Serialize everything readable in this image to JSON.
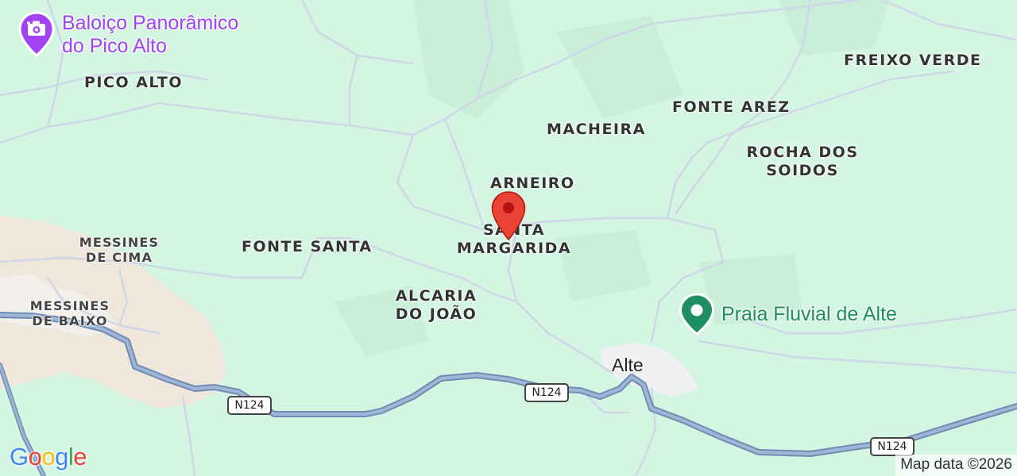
{
  "map": {
    "background_color": "#d3f5e1",
    "urban_color": "#efe6dc",
    "road_color": "#8aa5c8",
    "road_outline_color": "#6f8cb3",
    "minor_road_color": "#cfd6e6",
    "place_labels": [
      {
        "id": "pico-alto",
        "text": "PICO ALTO"
      },
      {
        "id": "freixo-verde",
        "text": "FREIXO VERDE"
      },
      {
        "id": "fonte-arez",
        "text": "FONTE AREZ"
      },
      {
        "id": "macheira",
        "text": "MACHEIRA"
      },
      {
        "id": "rocha-dos-soidos",
        "text": "ROCHA DOS\nSOIDOS"
      },
      {
        "id": "arneiro",
        "text": "ARNEIRO"
      },
      {
        "id": "santa-margarida",
        "text": "SANTA\nMARGARIDA"
      },
      {
        "id": "fonte-santa",
        "text": "FONTE SANTA"
      },
      {
        "id": "messines-de-cima",
        "text": "MESSINES\nDE CIMA"
      },
      {
        "id": "messines-de-baixo",
        "text": "MESSINES\nDE BAIXO"
      },
      {
        "id": "alcaria-do-joao",
        "text": "ALCARIA\nDO JOÃO"
      }
    ],
    "town_label": "Alte",
    "road_shields": [
      "N124",
      "N124",
      "N124"
    ],
    "pois": [
      {
        "id": "baloico",
        "text": "Baloiço Panorâmico\ndo Pico Alto",
        "color": "#a142f4",
        "icon": "camera-icon"
      },
      {
        "id": "praia-fluvial",
        "text": "Praia Fluvial de Alte",
        "color": "#1e8e63",
        "icon": "dot-icon"
      }
    ],
    "marker": {
      "icon": "location-pin-icon",
      "color": "#ea4335"
    },
    "logo": "Google",
    "logo_colors": [
      "#4285f4",
      "#ea4335",
      "#fbbc05",
      "#4285f4",
      "#34a853",
      "#ea4335"
    ],
    "attribution": "Map data ©2026"
  }
}
